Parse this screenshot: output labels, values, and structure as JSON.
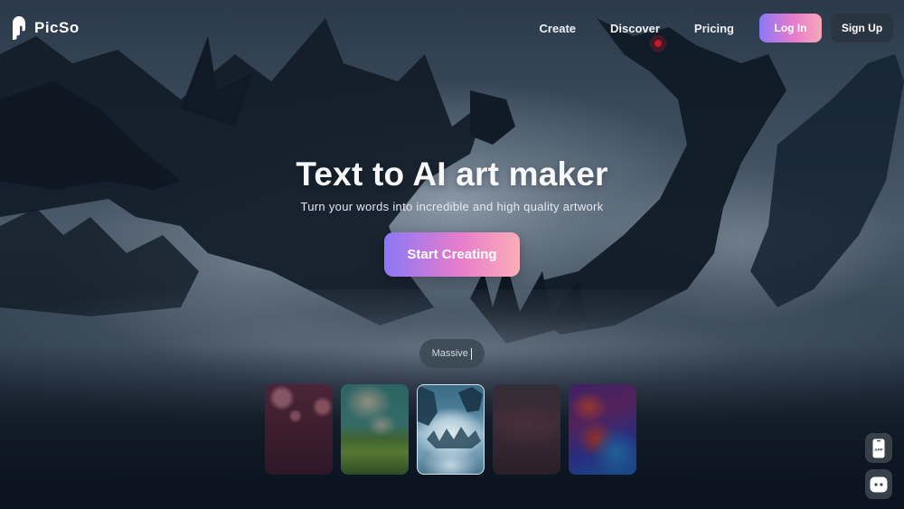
{
  "brand": {
    "name": "PicSo",
    "logo_icon": "picso-logo-icon"
  },
  "nav": {
    "links": [
      {
        "label": "Create"
      },
      {
        "label": "Discover"
      },
      {
        "label": "Pricing"
      }
    ],
    "login_label": "Log In",
    "signup_label": "Sign Up"
  },
  "hero": {
    "title": "Text to AI art maker",
    "subtitle": "Turn your words into incredible and high quality artwork",
    "cta_label": "Start Creating"
  },
  "prompt": {
    "typed_text": "Massive"
  },
  "gallery": {
    "items": [
      {
        "theme": "gothic-ruins-red",
        "selected": false
      },
      {
        "theme": "green-landscape-clouds",
        "selected": false
      },
      {
        "theme": "dragons-in-clouds",
        "selected": true
      },
      {
        "theme": "crowd-scene-dark",
        "selected": false
      },
      {
        "theme": "abstract-fluid-colors",
        "selected": false
      }
    ]
  },
  "floating": {
    "app_label": "APP",
    "app_icon": "phone-app-icon",
    "chat_icon": "chat-bot-icon"
  },
  "colors": {
    "accent_gradient_start": "#8a78f7",
    "accent_gradient_mid": "#e77ccc",
    "accent_gradient_end": "#fbadb8",
    "signup_bg": "#283440",
    "background_dark": "#0c1420"
  }
}
